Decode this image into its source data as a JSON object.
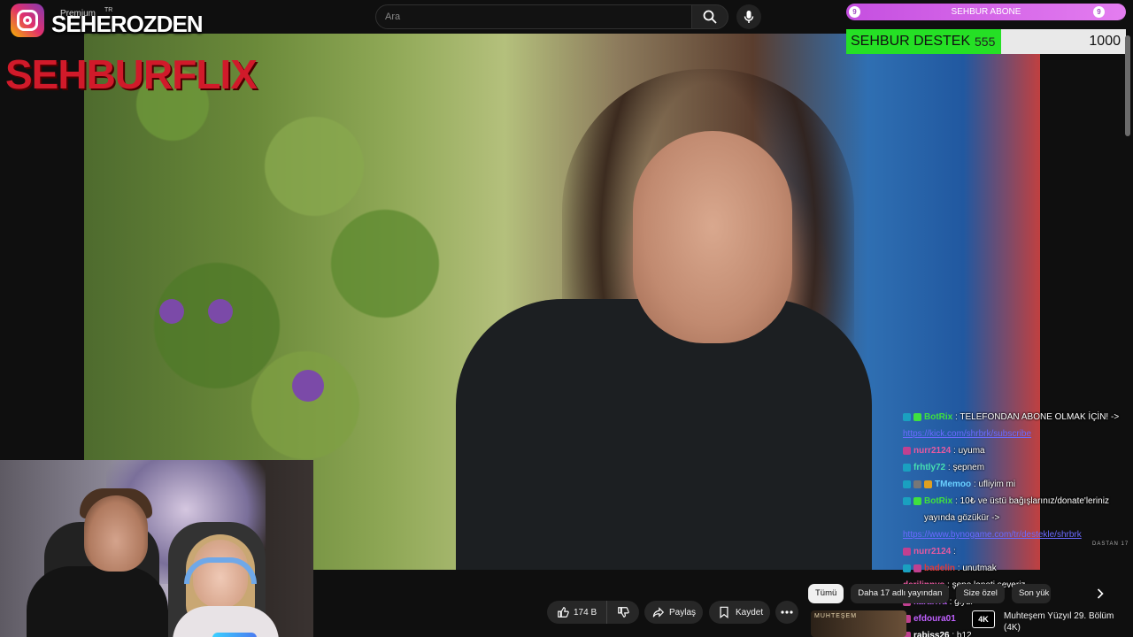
{
  "overlay": {
    "premium_label": "Premium",
    "premium_country": "TR",
    "channel_name": "SEHEROZDEN",
    "brand": "SEHBURFLIX",
    "subscriber_goal": {
      "label": "SEHBUR ABONE",
      "left_badge": "9",
      "right_badge": "9"
    },
    "donation_goal": {
      "label": "SEHBUR DESTEK",
      "current": "555",
      "goal": "1000",
      "progress": 0.555,
      "fill_color": "#25e025"
    }
  },
  "topbar": {
    "search_placeholder": "Ara",
    "search_icon": "search-icon",
    "mic_icon": "microphone-icon"
  },
  "video": {
    "watermark": "DASTAN 17"
  },
  "chat": [
    {
      "user": "BotRix",
      "user_color": "#3fe03f",
      "text": ": TELEFONDAN ABONE OLMAK İÇİN! ->",
      "badges": [
        "#1aa0c0",
        "#3fe03f"
      ]
    },
    {
      "user": "",
      "user_color": "#6a6aff",
      "text": "",
      "link": "https://kick.com/shrbrk/subscribe",
      "badges": []
    },
    {
      "user": "nurr2124",
      "user_color": "#e85aa0",
      "text": ": uyuma",
      "badges": [
        "#c04090"
      ]
    },
    {
      "user": "frhtly72",
      "user_color": "#46e0b0",
      "text": ": şepnem",
      "badges": [
        "#1aa0c0"
      ]
    },
    {
      "user": "TMemoo",
      "user_color": "#6ad0ff",
      "text": ": ufliyim mi",
      "badges": [
        "#1aa0c0",
        "#777",
        "#e0a020"
      ]
    },
    {
      "user": "BotRix",
      "user_color": "#3fe03f",
      "text": ": 10₺ ve üstü bağışlarınız/donate'leriniz yayında gözükür ->",
      "badges": [
        "#1aa0c0",
        "#3fe03f"
      ]
    },
    {
      "user": "",
      "user_color": "#6a6aff",
      "text": "",
      "link": "https://www.bynogame.com/tr/destekle/shrbrk",
      "badges": []
    },
    {
      "user": "nurr2124",
      "user_color": "#e85aa0",
      "text": ":",
      "badges": [
        "#c04090"
      ]
    },
    {
      "user": "badelin",
      "user_color": "#e03a3a",
      "text": ": unutmak",
      "badges": [
        "#1aa0c0",
        "#c04090"
      ]
    },
    {
      "user": "derilinnys",
      "user_color": "#e85aa0",
      "text": ": şepo laneti severiz",
      "badges": []
    },
    {
      "user": "kararrra",
      "user_color": "#c060ff",
      "text": ": giydi",
      "badges": [
        "#c04090"
      ]
    },
    {
      "user": "efdoura01",
      "user_color": "#c060ff",
      "text": "",
      "badges": [
        "#c04090"
      ]
    },
    {
      "user": "rabiss26",
      "user_color": "#ffffff",
      "text": ": b12",
      "badges": [
        "#c04090"
      ]
    }
  ],
  "actions": {
    "like_count": "174 B",
    "share": "Paylaş",
    "save": "Kaydet"
  },
  "chips": [
    "Tümü",
    "Daha 17 adlı yayından",
    "Size özel",
    "Son yük"
  ],
  "recommendation": {
    "thumb_text": "MUHTEŞEM",
    "badge": "4K",
    "title": "Muhteşem Yüzyıl 29. Bölüm (4K)"
  }
}
